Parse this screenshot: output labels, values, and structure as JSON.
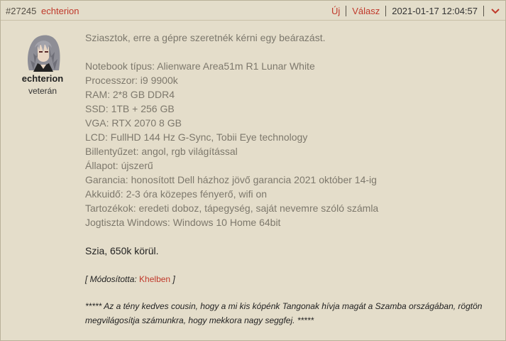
{
  "post": {
    "id": "#27245",
    "author": "echterion",
    "actions": {
      "new": "Új",
      "reply": "Válasz"
    },
    "date": "2021-01-17 12:04:57"
  },
  "user": {
    "name": "echterion",
    "rank": "veterán"
  },
  "content": {
    "greeting": "Sziasztok, erre a gépre szeretnék kérni egy beárazást.",
    "specs": [
      "Notebook típus: Alienware Area51m R1 Lunar White",
      "Processzor: i9 9900k",
      "RAM: 2*8 GB DDR4",
      "SSD: 1TB + 256 GB",
      "VGA: RTX 2070 8 GB",
      "LCD: FullHD 144 Hz G-Sync, Tobii Eye technology",
      "Billentyűzet: angol, rgb világítással",
      "Állapot: újszerű",
      "Garancia: honosított Dell házhoz jövő garancia 2021 október 14-ig",
      "Akkuidő: 2-3 óra közepes fényerő, wifi on",
      "Tartozékok: eredeti doboz, tápegység, saját nevemre szóló számla",
      "Jogtiszta Windows: Windows 10 Home 64bit"
    ],
    "price": "Szia, 650k körül.",
    "modified_prefix": "[ Módosította: ",
    "modified_by": "Khelben",
    "modified_suffix": " ]",
    "signature": "***** Az a tény kedves cousin, hogy a mi kis kópénk Tangonak hívja magát a Szamba országában, rögtön megvilágosítja számunkra, hogy mekkora nagy seggfej. *****"
  },
  "icons": {
    "menu": "chevron-down-icon",
    "avatar": "avatar"
  },
  "colors": {
    "accent": "#c0392b",
    "background": "#e4ddca"
  }
}
